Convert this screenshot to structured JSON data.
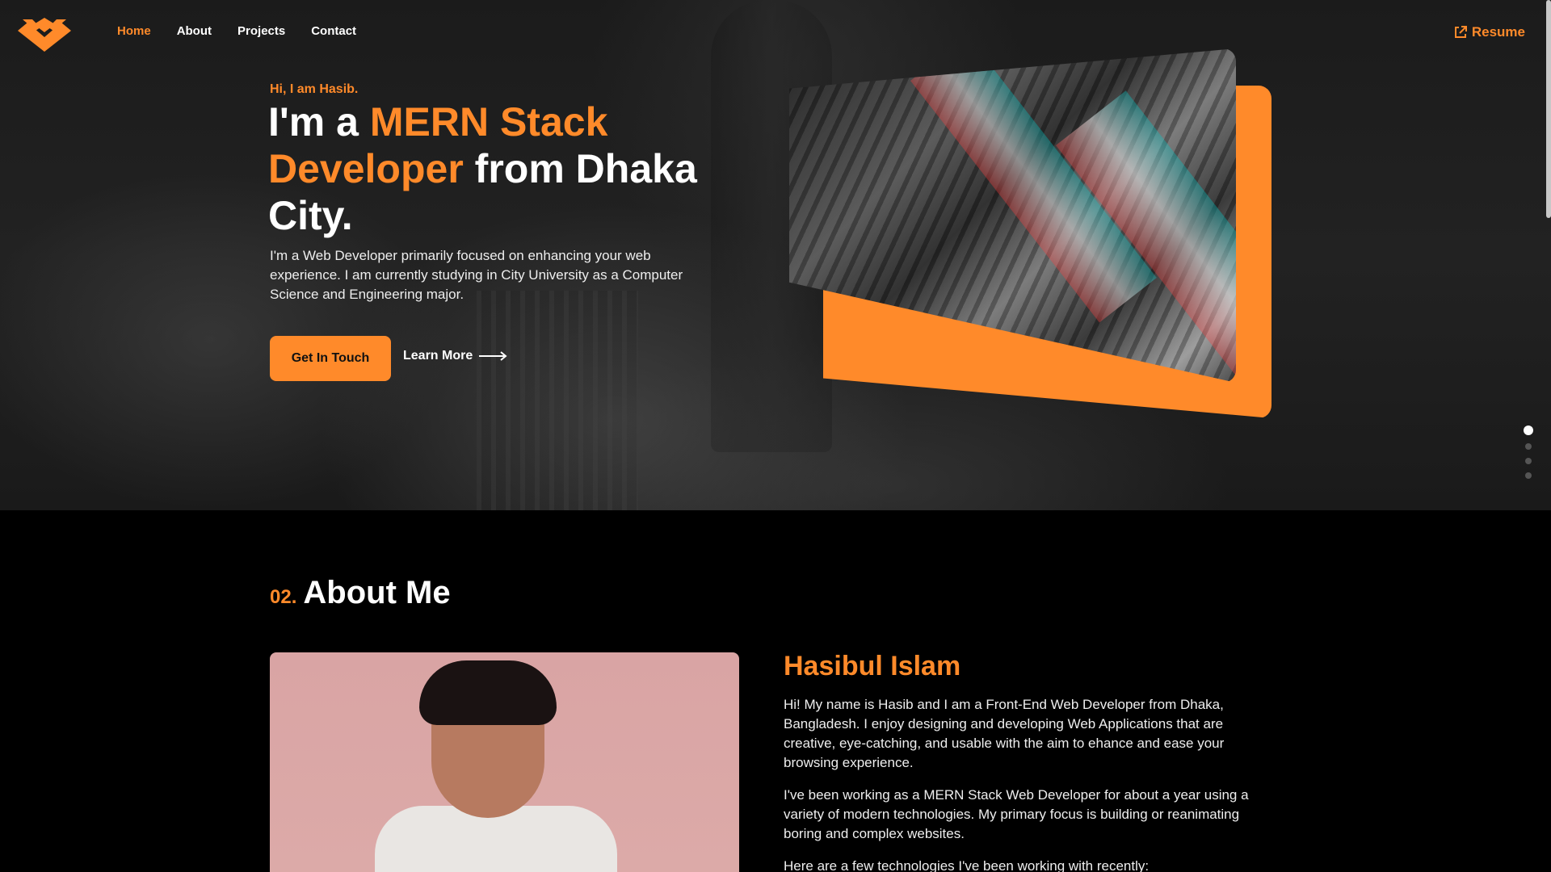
{
  "nav": {
    "items": [
      {
        "label": "Home",
        "active": true
      },
      {
        "label": "About",
        "active": false
      },
      {
        "label": "Projects",
        "active": false
      },
      {
        "label": "Contact",
        "active": false
      }
    ],
    "resume_label": "Resume"
  },
  "hero": {
    "greeting": "Hi, I am Hasib.",
    "headline_pre": "I'm a ",
    "headline_highlight": "MERN Stack Developer",
    "headline_post": " from Dhaka City.",
    "intro": "I'm a Web Developer primarily focused on enhancing your web experience. I am currently studying in City University as a Computer Science and Engineering major.",
    "cta_primary": "Get In Touch",
    "cta_secondary": "Learn More"
  },
  "slider": {
    "count": 4,
    "active_index": 0
  },
  "about": {
    "number": "02.",
    "title": "About Me",
    "name": "Hasibul Islam",
    "paragraph1": "Hi! My name is Hasib and I am a Front-End Web Developer from Dhaka, Bangladesh. I enjoy designing and developing Web Applications that are creative, eye-catching, and usable with the aim to ehance and ease your browsing experience.",
    "paragraph2": "I've been working as a MERN Stack Web Developer for about a year using a variety of modern technologies. My primary focus is building or reanimating boring and complex websites.",
    "paragraph3": "Here are a few technologies I've been working with recently:"
  },
  "colors": {
    "accent": "#ff8a2a",
    "background": "#000000"
  }
}
